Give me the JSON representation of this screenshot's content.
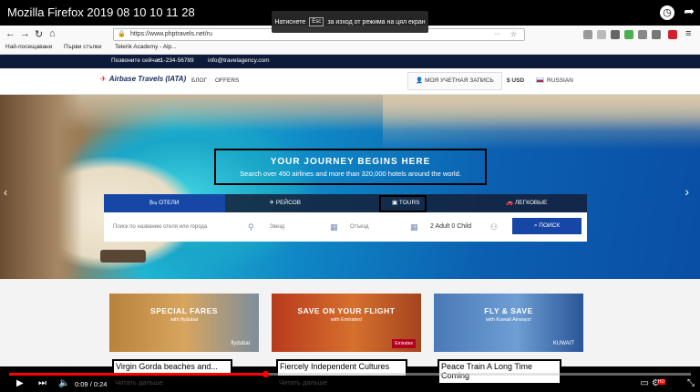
{
  "video": {
    "title": "Mozilla Firefox 2019 08 10 10 11 28",
    "time_current": "0:09",
    "time_total": "0:24",
    "progress": 0.375
  },
  "fullscreen_hint": {
    "before": "Натиснете",
    "key": "Esc",
    "after": "за изход от режима на цял екран"
  },
  "browser": {
    "url": "https://www.phptravels.net/ru",
    "bookmarks": [
      "Най-посещавани",
      "Първи стъпки",
      "Telerik Academy - Alp..."
    ]
  },
  "topbar": {
    "phone_label": "Позвоните сейчас:",
    "phone": "+1-234-56789",
    "email": "info@travelagency.com"
  },
  "header": {
    "logo": "Airbase Travels",
    "logo_suffix": "(IATA)",
    "nav": [
      "БЛОГ",
      "OFFERS"
    ],
    "account": "МОЯ УЧЕТНАЯ ЗАПИСЬ",
    "currency": "USD",
    "language": "RUSSIAN"
  },
  "hero": {
    "title": "YOUR JOURNEY BEGINS HERE",
    "subtitle": "Search over 450 airlines and more than 320,000 hotels around the world."
  },
  "search": {
    "tabs": [
      "ОТЕЛИ",
      "РЕЙСОВ",
      "TOURS",
      "ЛЕГКОВЫЕ"
    ],
    "active_tab": 0,
    "placeholder": "Поиск по названию отеля или города",
    "checkin": "Звезд",
    "checkout": "Отъезд",
    "guests": "2 Adult 0 Child",
    "button": "ПОИСК"
  },
  "cards": [
    {
      "title": "SPECIAL FARES",
      "sub": "with flydubai",
      "brand": "flydubai"
    },
    {
      "title": "SAVE ON YOUR FLIGHT",
      "sub": "with Emirates!",
      "brand": "Emirates"
    },
    {
      "title": "FLY & SAVE",
      "sub": "with Kuwait Airways!",
      "brand": "KUWAIT"
    }
  ],
  "captions": [
    "Virgin Gorda beaches and...",
    "Fiercely Independent Cultures",
    "Peace Train A Long Time Coming"
  ],
  "read_more": "Читать дальше",
  "colors": {
    "accent": "#1747a6",
    "topbar": "#0e1a3a",
    "progress": "#ff0000"
  }
}
